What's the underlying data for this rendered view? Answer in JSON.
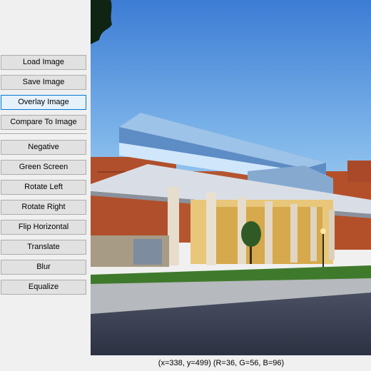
{
  "toolbar": {
    "buttons": [
      {
        "label": "Load Image"
      },
      {
        "label": "Save Image"
      },
      {
        "label": "Overlay Image",
        "focused": true
      },
      {
        "label": "Compare To Image"
      },
      {
        "label": "Negative"
      },
      {
        "label": "Green Screen"
      },
      {
        "label": "Rotate Left"
      },
      {
        "label": "Rotate Right"
      },
      {
        "label": "Flip Horizontal"
      },
      {
        "label": "Translate"
      },
      {
        "label": "Blur"
      },
      {
        "label": "Equalize"
      }
    ]
  },
  "status": {
    "text": "(x=338, y=499) (R=36, G=56, B=96)"
  },
  "colors": {
    "sky_top": "#3f7fd6",
    "sky_bottom": "#a9d3f2",
    "brick": "#b5512d",
    "grass": "#3f7a2c",
    "road": "#3a3f4f"
  }
}
